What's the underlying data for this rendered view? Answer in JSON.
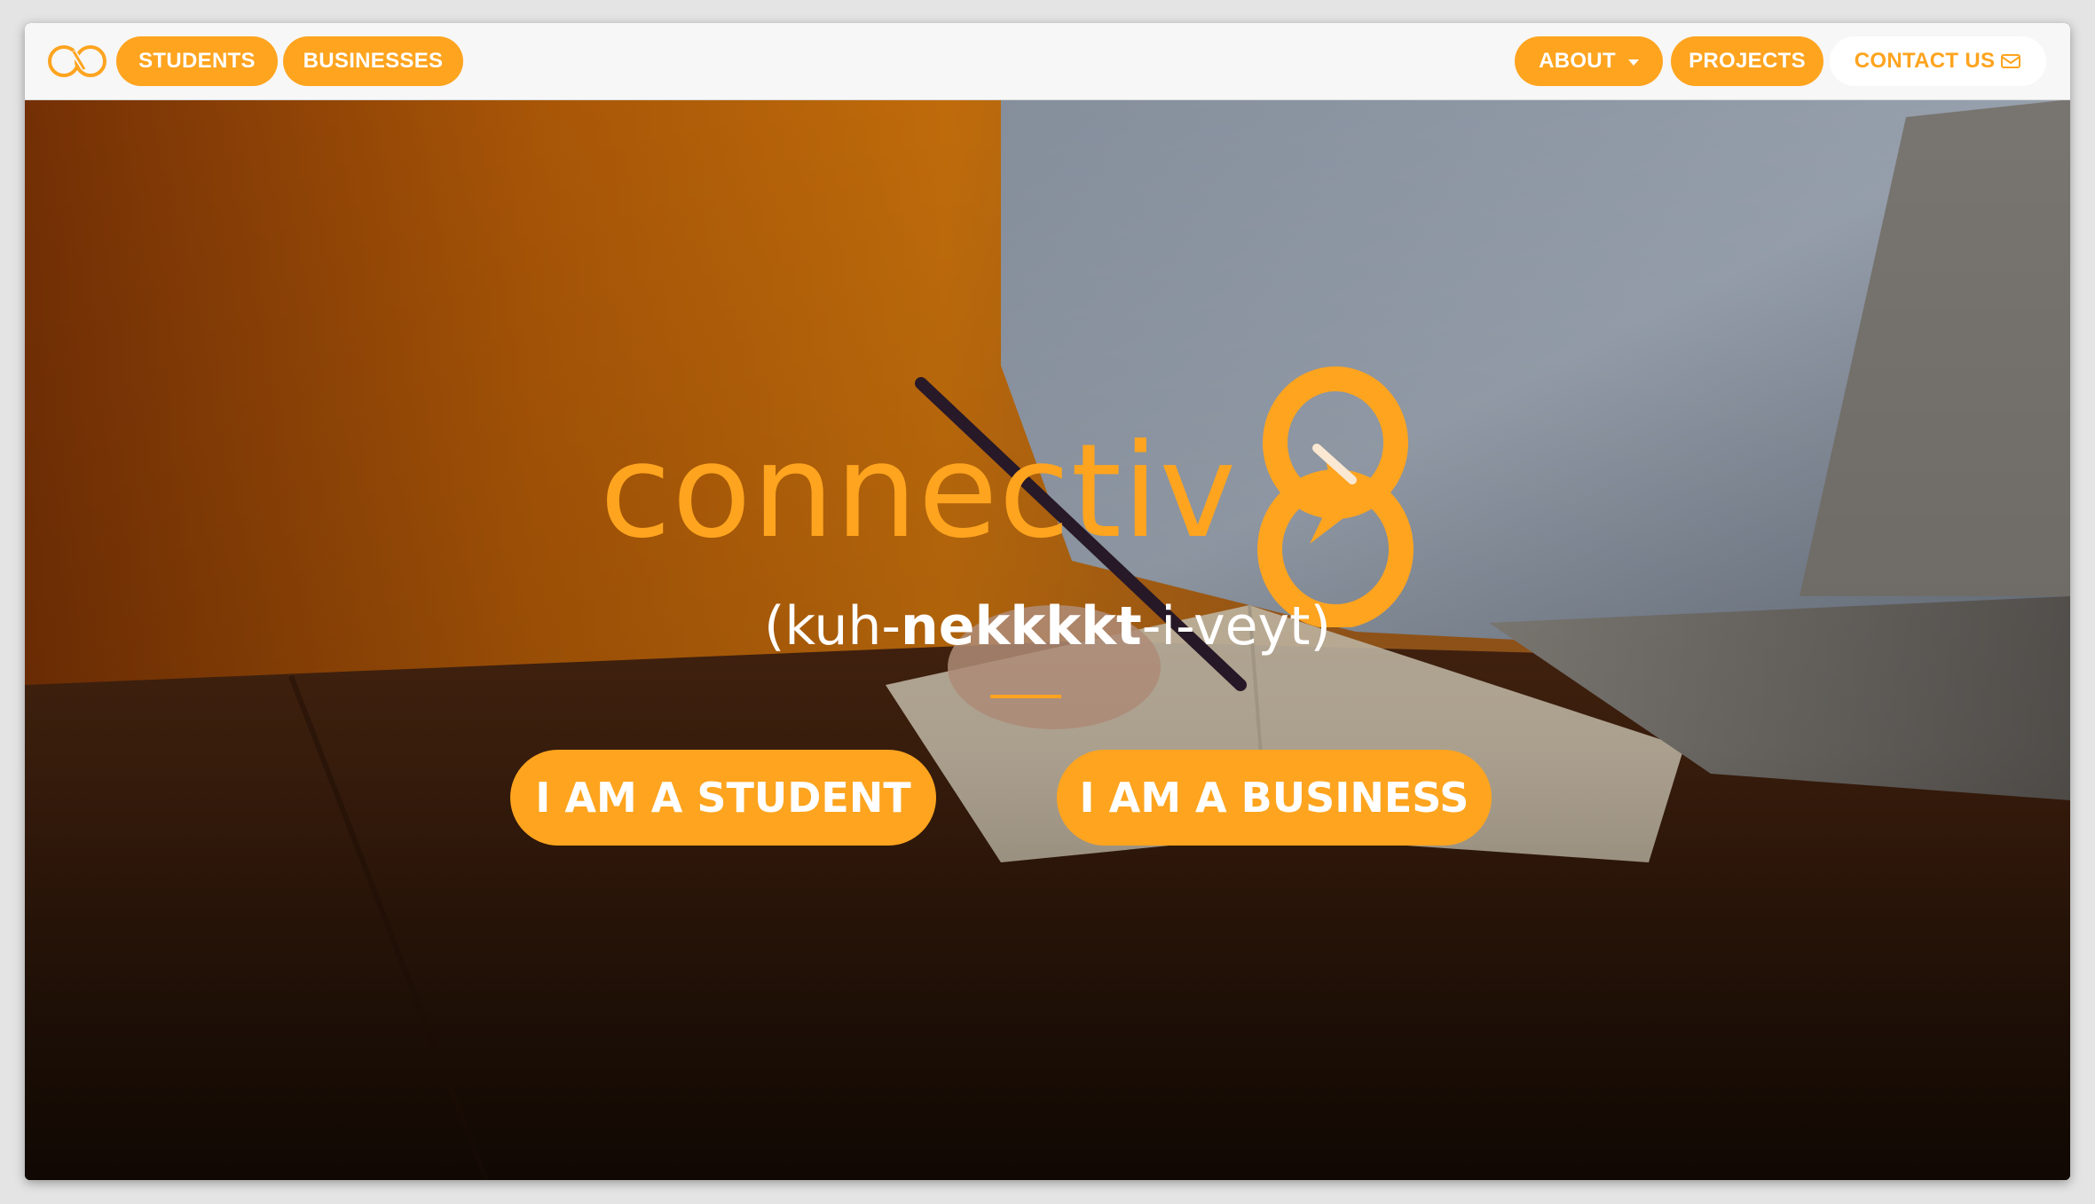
{
  "nav": {
    "logo_icon": "connectiv8-infinity-logo-icon",
    "left_links": [
      "STUDENTS",
      "BUSINESSES"
    ],
    "right_links": {
      "about": "ABOUT",
      "projects": "PROJECTS",
      "contact": "CONTACT US"
    },
    "icons": {
      "about_caret": "chevron-down-icon",
      "contact": "envelope-icon"
    }
  },
  "hero": {
    "brand_word": "connectiv",
    "brand_glyph": "8",
    "pronunciation": {
      "open": "(kuh-",
      "stress": "nekkkkt",
      "rest": "-i-veyt)"
    },
    "buttons": {
      "student": "I AM A STUDENT",
      "business": "I AM A BUSINESS"
    }
  },
  "colors": {
    "accent": "#fea41f",
    "navbar_bg": "#f7f7f8",
    "text_light": "#ffffff"
  }
}
